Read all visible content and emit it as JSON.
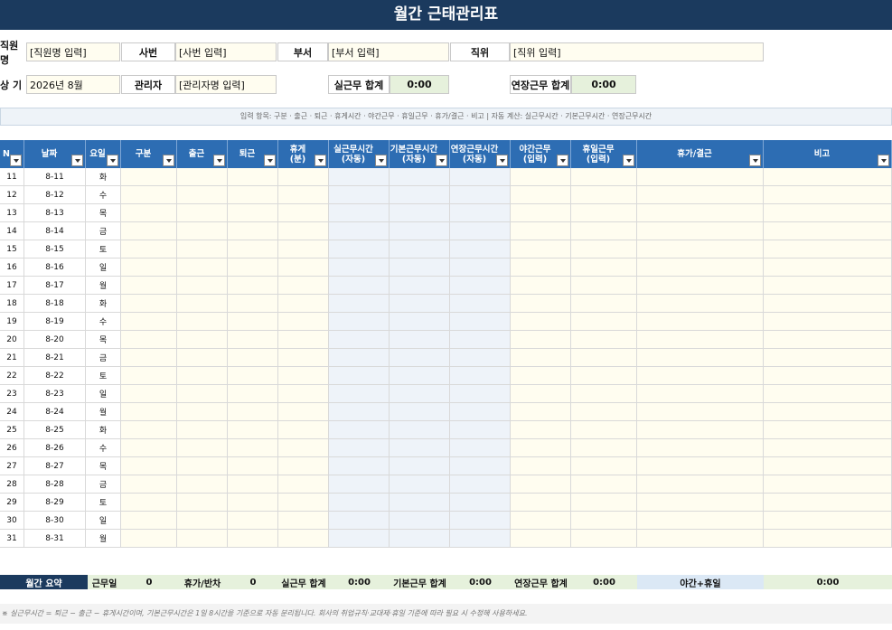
{
  "title": "월간 근태관리표",
  "info_row1": [
    {
      "label": "직원명",
      "value": "[직원명 입력]"
    },
    {
      "label": "사번",
      "value": "[사번 입력]"
    },
    {
      "label": "부서",
      "value": "[부서 입력]"
    },
    {
      "label": "직위",
      "value": "[직위 입력]"
    }
  ],
  "info_row2": {
    "period_label": "상 기",
    "period_value": "2026년 8월",
    "manager_label": "관리자",
    "manager_value": "[관리자명 입력]",
    "actual_label": "실근무 합계",
    "actual_value": "0:00",
    "overtime_label": "연장근무 합계",
    "overtime_value": "0:00"
  },
  "hint": "입력 항목: 구분 · 출근 · 퇴근 · 휴게시간 · 야간근무 · 휴일근무 · 휴가/결근 · 비고  |  자동 계산: 실근무시간 · 기본근무시간 · 연장근무시간",
  "headers": [
    {
      "l1": "N",
      "l2": ""
    },
    {
      "l1": "날짜",
      "l2": ""
    },
    {
      "l1": "요일",
      "l2": ""
    },
    {
      "l1": "구분",
      "l2": ""
    },
    {
      "l1": "출근",
      "l2": ""
    },
    {
      "l1": "퇴근",
      "l2": ""
    },
    {
      "l1": "휴게",
      "l2": "(분)"
    },
    {
      "l1": "실근무시간",
      "l2": "(자동)"
    },
    {
      "l1": "기본근무시간",
      "l2": "(자동)"
    },
    {
      "l1": "연장근무시간",
      "l2": "(자동)"
    },
    {
      "l1": "야간근무",
      "l2": "(입력)"
    },
    {
      "l1": "휴일근무",
      "l2": "(입력)"
    },
    {
      "l1": "휴가/결근",
      "l2": ""
    },
    {
      "l1": "비고",
      "l2": ""
    }
  ],
  "rows": [
    {
      "no": "11",
      "date": "8-11",
      "day": "화"
    },
    {
      "no": "12",
      "date": "8-12",
      "day": "수"
    },
    {
      "no": "13",
      "date": "8-13",
      "day": "목"
    },
    {
      "no": "14",
      "date": "8-14",
      "day": "금"
    },
    {
      "no": "15",
      "date": "8-15",
      "day": "토"
    },
    {
      "no": "16",
      "date": "8-16",
      "day": "일"
    },
    {
      "no": "17",
      "date": "8-17",
      "day": "월"
    },
    {
      "no": "18",
      "date": "8-18",
      "day": "화"
    },
    {
      "no": "19",
      "date": "8-19",
      "day": "수"
    },
    {
      "no": "20",
      "date": "8-20",
      "day": "목"
    },
    {
      "no": "21",
      "date": "8-21",
      "day": "금"
    },
    {
      "no": "22",
      "date": "8-22",
      "day": "토"
    },
    {
      "no": "23",
      "date": "8-23",
      "day": "일"
    },
    {
      "no": "24",
      "date": "8-24",
      "day": "월"
    },
    {
      "no": "25",
      "date": "8-25",
      "day": "화"
    },
    {
      "no": "26",
      "date": "8-26",
      "day": "수"
    },
    {
      "no": "27",
      "date": "8-27",
      "day": "목"
    },
    {
      "no": "28",
      "date": "8-28",
      "day": "금"
    },
    {
      "no": "29",
      "date": "8-29",
      "day": "토"
    },
    {
      "no": "30",
      "date": "8-30",
      "day": "일"
    },
    {
      "no": "31",
      "date": "8-31",
      "day": "월"
    }
  ],
  "summary": {
    "title": "월간 요약",
    "workdays_label": "근무일",
    "workdays_value": "0",
    "leave_label": "휴가/반차",
    "leave_value": "0",
    "actual_label": "실근무 합계",
    "actual_value": "0:00",
    "basic_label": "기본근무 합계",
    "basic_value": "0:00",
    "overtime_label": "연장근무 합계",
    "overtime_value": "0:00",
    "night_label": "야간+휴일",
    "night_value": "0:00"
  },
  "footnote": "※ 실근무시간 = 퇴근 − 출근 − 휴게시간이며, 기본근무시간은 1일 8시간을 기준으로 자동 분리됩니다. 회사의 취업규칙·교대제·휴일 기준에 따라 필요 시 수정해 사용하세요.",
  "colors": {
    "title_bg": "#1b3a5e",
    "header_bg": "#2d6db3",
    "input_bg": "#fffdf0",
    "auto_bg": "#eef3f9",
    "sum_bg": "#e6f1dc"
  }
}
